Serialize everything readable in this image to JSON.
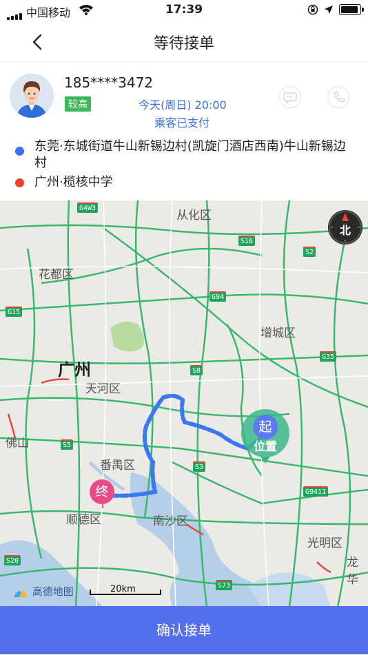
{
  "status_bar": {
    "carrier": "中国移动",
    "time": "17:39"
  },
  "nav": {
    "title": "等待接单"
  },
  "passenger": {
    "phone": "185****3472",
    "badge": "较高",
    "time": "今天(周日) 20:00",
    "payment_status": "乘客已支付"
  },
  "route": {
    "start": "东莞·东城街道牛山新锡边村(凯旋门酒店西南)牛山新锡边村",
    "end": "广州·榄核中学",
    "start_color": "#3a6ff0",
    "end_color": "#e8442c"
  },
  "map": {
    "labels": {
      "conghua": "从化区",
      "huadu": "花都区",
      "guangzhou": "广州",
      "tianhe": "天河区",
      "zengcheng": "增城区",
      "foshan": "佛山",
      "panyu": "番禺区",
      "shunde": "顺德区",
      "nansha": "南沙区",
      "guangming": "光明区",
      "longhua": "龙华"
    },
    "highways": {
      "g4w3": "G4W3",
      "s16": "S16",
      "s2": "S2",
      "g94": "G94",
      "g15": "G15",
      "g35": "G35",
      "s8": "S8",
      "s5": "S5",
      "s3": "S3",
      "g9411": "G9411",
      "s20": "S20",
      "s73": "S73"
    },
    "compass_label": "北",
    "start_pin": "起",
    "start_location": "位置",
    "end_pin": "终",
    "scale": "20km",
    "logo": "高德地图"
  },
  "actions": {
    "confirm": "确认接单"
  }
}
